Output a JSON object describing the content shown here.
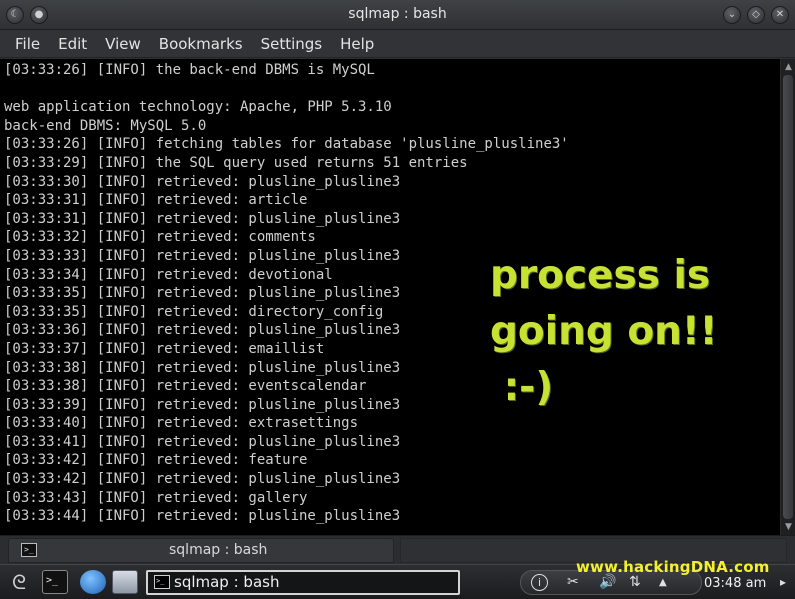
{
  "window": {
    "title": "sqlmap : bash",
    "menu": [
      "File",
      "Edit",
      "View",
      "Bookmarks",
      "Settings",
      "Help"
    ]
  },
  "terminal": {
    "lines": [
      "[03:33:26] [INFO] the back-end DBMS is MySQL",
      "",
      "web application technology: Apache, PHP 5.3.10",
      "back-end DBMS: MySQL 5.0",
      "[03:33:26] [INFO] fetching tables for database 'plusline_plusline3'",
      "[03:33:29] [INFO] the SQL query used returns 51 entries",
      "[03:33:30] [INFO] retrieved: plusline_plusline3",
      "[03:33:31] [INFO] retrieved: article",
      "[03:33:31] [INFO] retrieved: plusline_plusline3",
      "[03:33:32] [INFO] retrieved: comments",
      "[03:33:33] [INFO] retrieved: plusline_plusline3",
      "[03:33:34] [INFO] retrieved: devotional",
      "[03:33:35] [INFO] retrieved: plusline_plusline3",
      "[03:33:35] [INFO] retrieved: directory_config",
      "[03:33:36] [INFO] retrieved: plusline_plusline3",
      "[03:33:37] [INFO] retrieved: emaillist",
      "[03:33:38] [INFO] retrieved: plusline_plusline3",
      "[03:33:38] [INFO] retrieved: eventscalendar",
      "[03:33:39] [INFO] retrieved: plusline_plusline3",
      "[03:33:40] [INFO] retrieved: extrasettings",
      "[03:33:41] [INFO] retrieved: plusline_plusline3",
      "[03:33:42] [INFO] retrieved: feature",
      "[03:33:42] [INFO] retrieved: plusline_plusline3",
      "[03:33:43] [INFO] retrieved: gallery",
      "[03:33:44] [INFO] retrieved: plusline_plusline3"
    ],
    "overlay": [
      "process is",
      "going on!!",
      " :-)"
    ],
    "overlay_color": "#c8e234"
  },
  "tabbar": {
    "tab_label": "sqlmap : bash"
  },
  "taskbar": {
    "task_label": "sqlmap : bash",
    "clock": "03:48 am",
    "tray_icons": [
      "info-icon",
      "scissors-icon",
      "volume-icon",
      "network-icon",
      "expand-icon"
    ]
  },
  "watermark": "www.hackingDNA.com",
  "colors": {
    "watermark": "#f3f030",
    "terminal_bg": "#000000",
    "terminal_fg": "#cfcfcf"
  }
}
